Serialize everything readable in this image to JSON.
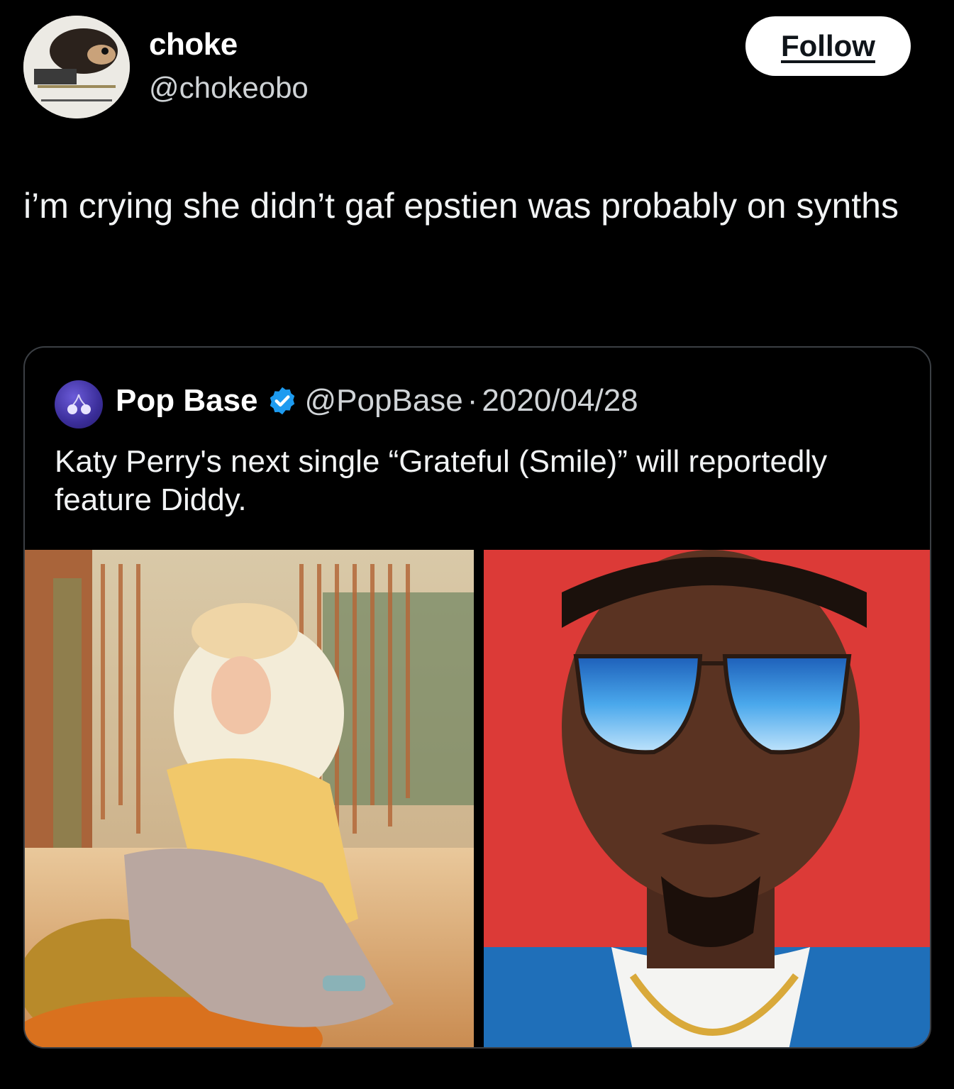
{
  "tweet": {
    "author": {
      "display_name": "choke",
      "handle": "@chokeobo"
    },
    "follow_label": "Follow",
    "text": "i’m crying she didn’t gaf epstien was probably on synths"
  },
  "quoted_tweet": {
    "author": {
      "display_name": "Pop Base",
      "handle": "@PopBase",
      "verified": true
    },
    "separator": "·",
    "date": "2020/04/28",
    "text": "Katy Perry's next single “Grateful (Smile)” will reportedly feature Diddy.",
    "media": [
      {
        "name": "photo-katy-perry"
      },
      {
        "name": "photo-diddy"
      }
    ]
  },
  "colors": {
    "background": "#000000",
    "verified_badge": "#1d9bf0",
    "card_border": "#3b3f44"
  }
}
